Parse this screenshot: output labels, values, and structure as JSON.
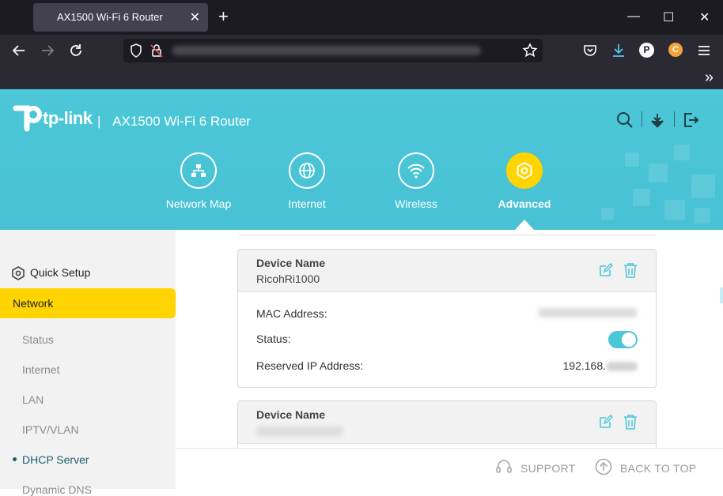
{
  "browser": {
    "tab_title": "AX1500 Wi-Fi 6 Router",
    "tab_close": "✕",
    "new_tab": "+",
    "window_controls": {
      "minimize": "—",
      "maximize": "☐",
      "close": "✕"
    },
    "nav_icons": [
      "back-arrow-icon",
      "forward-arrow-icon",
      "reload-icon",
      "shield-icon",
      "lock-icon",
      "bookmark-star-icon",
      "pocket-icon",
      "download-icon",
      "profile-icon",
      "extension-icon",
      "menu-icon"
    ],
    "profile_letter": "P",
    "extension_letter": "C",
    "overflow_chevron": "»"
  },
  "header": {
    "brand": "tp-link",
    "separator": "|",
    "router_name": "AX1500 Wi-Fi 6 Router",
    "tabs": [
      {
        "label": "Network Map",
        "icon": "network-map-icon"
      },
      {
        "label": "Internet",
        "icon": "globe-icon"
      },
      {
        "label": "Wireless",
        "icon": "wifi-icon"
      },
      {
        "label": "Advanced",
        "icon": "gear-icon",
        "active": true
      }
    ],
    "accent_color": "#4cc7d8",
    "active_color": "#ffd400"
  },
  "sidebar": {
    "quick_setup": "Quick Setup",
    "section": "Network",
    "items": [
      "Status",
      "Internet",
      "LAN",
      "IPTV/VLAN",
      "DHCP Server",
      "Dynamic DNS"
    ],
    "active_item": "DHCP Server"
  },
  "cards": [
    {
      "device_name_label": "Device Name",
      "device_name": "RicohRi1000",
      "mac_label": "MAC Address:",
      "status_label": "Status:",
      "status_on": true,
      "ip_label": "Reserved IP Address:",
      "ip_prefix": "192.168."
    },
    {
      "device_name_label": "Device Name"
    }
  ],
  "footer": {
    "support": "SUPPORT",
    "back_to_top": "BACK TO TOP"
  }
}
